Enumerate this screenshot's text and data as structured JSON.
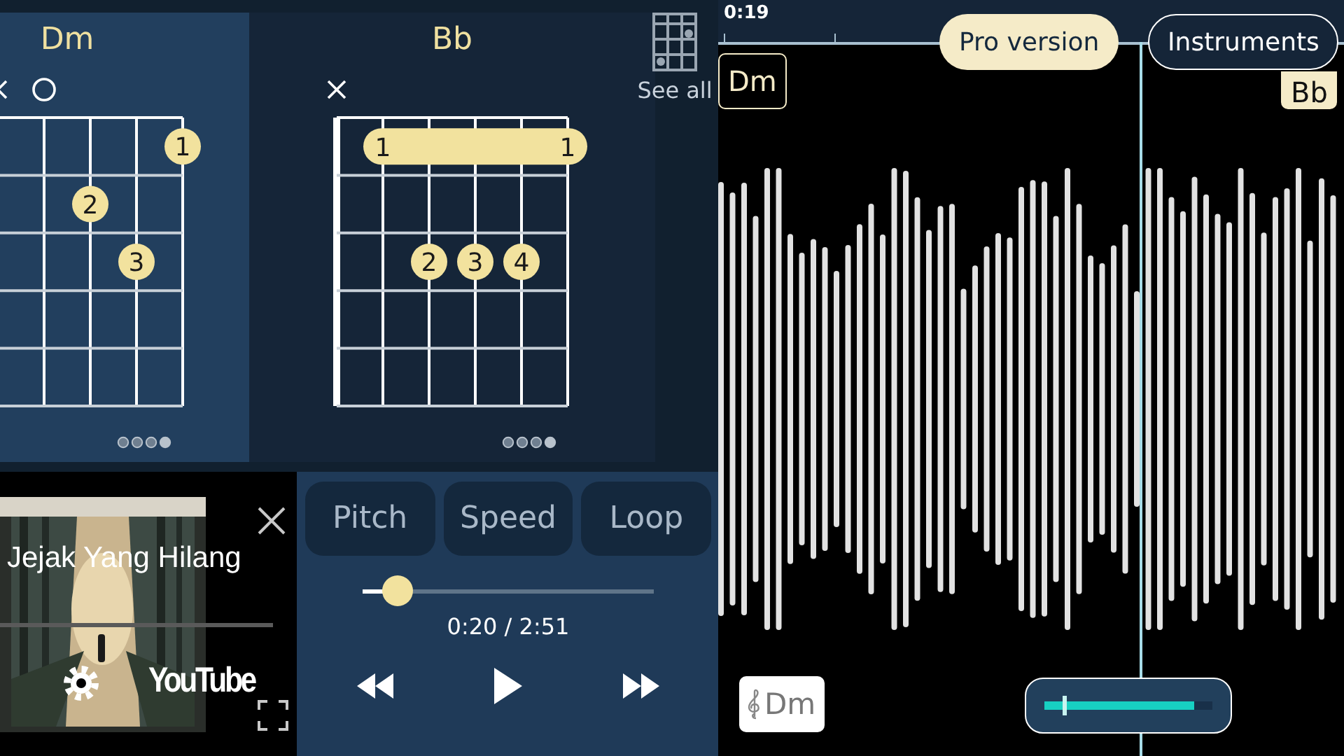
{
  "chords": [
    {
      "name": "Dm",
      "selected": true,
      "markers": [
        {
          "kind": "none"
        },
        {
          "kind": "mute"
        },
        {
          "kind": "open"
        },
        {
          "kind": "none"
        },
        {
          "kind": "none"
        },
        {
          "kind": "none"
        }
      ],
      "frets": [
        {
          "cells": [
            {
              "kind": "empty"
            },
            {
              "kind": "empty"
            },
            {
              "kind": "empty"
            },
            {
              "kind": "empty"
            },
            {
              "kind": "empty"
            },
            {
              "kind": "dot",
              "label": "1"
            }
          ]
        },
        {
          "cells": [
            {
              "kind": "empty"
            },
            {
              "kind": "empty"
            },
            {
              "kind": "empty"
            },
            {
              "kind": "dot",
              "label": "2"
            },
            {
              "kind": "empty"
            },
            {
              "kind": "empty"
            }
          ]
        },
        {
          "cells": [
            {
              "kind": "empty"
            },
            {
              "kind": "empty"
            },
            {
              "kind": "empty"
            },
            {
              "kind": "empty"
            },
            {
              "kind": "dot",
              "label": "3"
            },
            {
              "kind": "empty"
            }
          ]
        },
        {
          "cells": [
            {
              "kind": "empty"
            },
            {
              "kind": "empty"
            },
            {
              "kind": "empty"
            },
            {
              "kind": "empty"
            },
            {
              "kind": "empty"
            },
            {
              "kind": "empty"
            }
          ]
        },
        {
          "cells": [
            {
              "kind": "empty"
            },
            {
              "kind": "empty"
            },
            {
              "kind": "empty"
            },
            {
              "kind": "empty"
            },
            {
              "kind": "empty"
            },
            {
              "kind": "empty"
            }
          ]
        }
      ],
      "pages": [
        {
          "selected": false
        },
        {
          "selected": false
        },
        {
          "selected": false
        },
        {
          "selected": true
        }
      ]
    },
    {
      "name": "Bb",
      "selected": false,
      "markers": [
        {
          "kind": "mute"
        },
        {
          "kind": "none"
        },
        {
          "kind": "none"
        },
        {
          "kind": "none"
        },
        {
          "kind": "none"
        },
        {
          "kind": "none"
        }
      ],
      "frets": [
        {
          "cells": [
            {
              "kind": "empty"
            },
            {
              "kind": "barre_start",
              "label": "1"
            },
            {
              "kind": "barre"
            },
            {
              "kind": "barre"
            },
            {
              "kind": "barre"
            },
            {
              "kind": "barre_end",
              "label": "1"
            }
          ]
        },
        {
          "cells": [
            {
              "kind": "empty"
            },
            {
              "kind": "empty"
            },
            {
              "kind": "empty"
            },
            {
              "kind": "empty"
            },
            {
              "kind": "empty"
            },
            {
              "kind": "empty"
            }
          ]
        },
        {
          "cells": [
            {
              "kind": "empty"
            },
            {
              "kind": "empty"
            },
            {
              "kind": "dot",
              "label": "2"
            },
            {
              "kind": "dot",
              "label": "3"
            },
            {
              "kind": "dot",
              "label": "4"
            },
            {
              "kind": "empty"
            }
          ]
        },
        {
          "cells": [
            {
              "kind": "empty"
            },
            {
              "kind": "empty"
            },
            {
              "kind": "empty"
            },
            {
              "kind": "empty"
            },
            {
              "kind": "empty"
            },
            {
              "kind": "empty"
            }
          ]
        },
        {
          "cells": [
            {
              "kind": "empty"
            },
            {
              "kind": "empty"
            },
            {
              "kind": "empty"
            },
            {
              "kind": "empty"
            },
            {
              "kind": "empty"
            },
            {
              "kind": "empty"
            }
          ]
        }
      ],
      "pages": [
        {
          "selected": false
        },
        {
          "selected": false
        },
        {
          "selected": false
        },
        {
          "selected": true
        }
      ]
    }
  ],
  "see_all": {
    "label": "See all"
  },
  "video": {
    "title": "Jejak Yang Hilang",
    "brand": "YouTube"
  },
  "controls": {
    "tabs": [
      {
        "label": "Pitch",
        "selected": false
      },
      {
        "label": "Speed",
        "selected": false
      },
      {
        "label": "Loop",
        "selected": false
      }
    ],
    "position": {
      "level": 0.12
    },
    "time": "0:20 / 2:51"
  },
  "timeline": {
    "ticks": [
      "0:19"
    ],
    "pro_button": "Pro version",
    "instruments_button": "Instruments",
    "chord_marks": [
      {
        "label": "Dm",
        "selected": false
      },
      {
        "label": "Bb",
        "selected": true
      }
    ]
  },
  "key_button": {
    "label": "Dm"
  },
  "zoom_slider": {
    "level": 0.12
  }
}
